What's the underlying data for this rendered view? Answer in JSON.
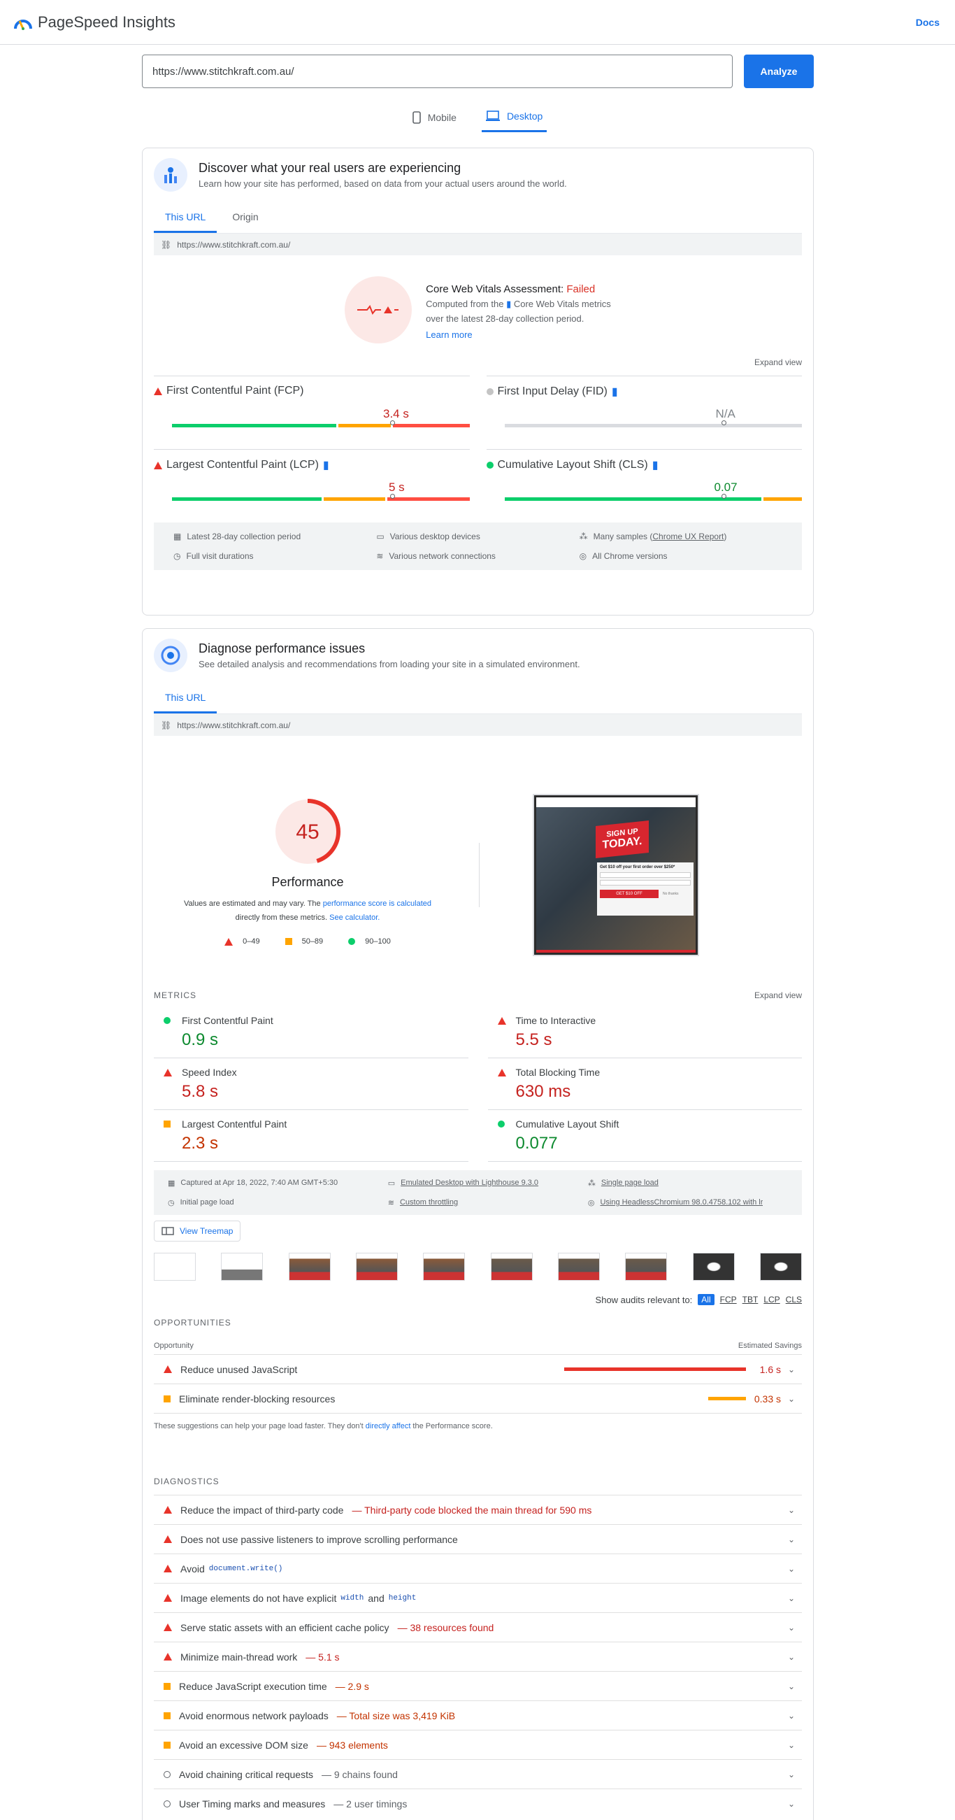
{
  "header": {
    "title": "PageSpeed Insights",
    "docs": "Docs"
  },
  "search": {
    "url": "https://www.stitchkraft.com.au/",
    "analyze": "Analyze"
  },
  "device_tabs": [
    {
      "label": "Mobile"
    },
    {
      "label": "Desktop"
    }
  ],
  "field": {
    "title": "Discover what your real users are experiencing",
    "subtitle": "Learn how your site has performed, based on data from your actual users around the world.",
    "tabs": [
      "This URL",
      "Origin"
    ],
    "url": "https://www.stitchkraft.com.au/",
    "assessment_label": "Core Web Vitals Assessment: ",
    "assessment_status": "Failed",
    "computed_a": "Computed from the",
    "computed_b": "Core Web Vitals metrics",
    "computed_c": "over the latest 28-day collection period.",
    "learn_more": "Learn more",
    "expand": "Expand view",
    "metrics": [
      {
        "name": "First Contentful Paint (FCP)",
        "value": "3.4 s"
      },
      {
        "name": "First Input Delay (FID)",
        "value": "N/A"
      },
      {
        "name": "Largest Contentful Paint (LCP)",
        "value": "5 s"
      },
      {
        "name": "Cumulative Layout Shift (CLS)",
        "value": "0.07"
      }
    ],
    "info": [
      "Latest 28-day collection period",
      "Various desktop devices",
      "Many samples (",
      "Chrome UX Report",
      ")",
      "Full visit durations",
      "Various network connections",
      "All Chrome versions"
    ]
  },
  "lab": {
    "title": "Diagnose performance issues",
    "subtitle": "See detailed analysis and recommendations from loading your site in a simulated environment.",
    "tab": "This URL",
    "url": "https://www.stitchkraft.com.au/",
    "score": "45",
    "score_value": 0.45,
    "score_label": "Performance",
    "note_a": "Values are estimated and may vary. The ",
    "note_link1": "performance score is calculated",
    "note_b": "directly from these metrics. ",
    "note_link2": "See calculator.",
    "legend": [
      "0–49",
      "50–89",
      "90–100"
    ],
    "metrics_label": "METRICS",
    "expand": "Expand view",
    "metrics": [
      {
        "name": "First Contentful Paint",
        "value": "0.9 s"
      },
      {
        "name": "Time to Interactive",
        "value": "5.5 s"
      },
      {
        "name": "Speed Index",
        "value": "5.8 s"
      },
      {
        "name": "Total Blocking Time",
        "value": "630 ms"
      },
      {
        "name": "Largest Contentful Paint",
        "value": "2.3 s"
      },
      {
        "name": "Cumulative Layout Shift",
        "value": "0.077"
      }
    ],
    "info": [
      "Captured at Apr 18, 2022, 7:40 AM GMT+5:30",
      "Emulated Desktop with Lighthouse 9.3.0",
      "Single page load",
      "Initial page load",
      "Custom throttling",
      "Using HeadlessChromium 98.0.4758.102 with lr"
    ],
    "treemap": "View Treemap",
    "screenshot_text": {
      "sign": "SIGN UP",
      "today": "TODAY.",
      "offer": "Get $10 off your first order over $250*",
      "cta": "GET $10 OFF",
      "no": "No thanks"
    },
    "relevant": "Show audits relevant to:",
    "filters": [
      "All",
      "FCP",
      "TBT",
      "LCP",
      "CLS"
    ],
    "opportunities_label": "OPPORTUNITIES",
    "opp_col1": "Opportunity",
    "opp_col2": "Estimated Savings",
    "opportunities": [
      {
        "title": "Reduce unused JavaScript",
        "savings": "1.6 s"
      },
      {
        "title": "Eliminate render-blocking resources",
        "savings": "0.33 s"
      }
    ],
    "opp_note_a": "These suggestions can help your page load faster. They don't ",
    "opp_note_link": "directly affect",
    "opp_note_b": " the Performance score.",
    "diagnostics_label": "DIAGNOSTICS",
    "diagnostics": [
      {
        "title": "Reduce the impact of third-party code",
        "detail": "— Third-party code blocked the main thread for 590 ms"
      },
      {
        "title": "Does not use passive listeners to improve scrolling performance",
        "detail": ""
      },
      {
        "title": "Avoid",
        "code": "document.write()",
        "detail": ""
      },
      {
        "title": "Image elements do not have explicit",
        "code": "width",
        "mid": "and",
        "code2": "height",
        "detail": ""
      },
      {
        "title": "Serve static assets with an efficient cache policy",
        "detail": "— 38 resources found"
      },
      {
        "title": "Minimize main-thread work",
        "detail": "— 5.1 s"
      },
      {
        "title": "Reduce JavaScript execution time",
        "detail": "— 2.9 s"
      },
      {
        "title": "Avoid enormous network payloads",
        "detail": "— Total size was 3,419 KiB"
      },
      {
        "title": "Avoid an excessive DOM size",
        "detail": "— 943 elements"
      },
      {
        "title": "Avoid chaining critical requests",
        "detail": "— 9 chains found"
      },
      {
        "title": "User Timing marks and measures",
        "detail": "— 2 user timings"
      }
    ]
  }
}
